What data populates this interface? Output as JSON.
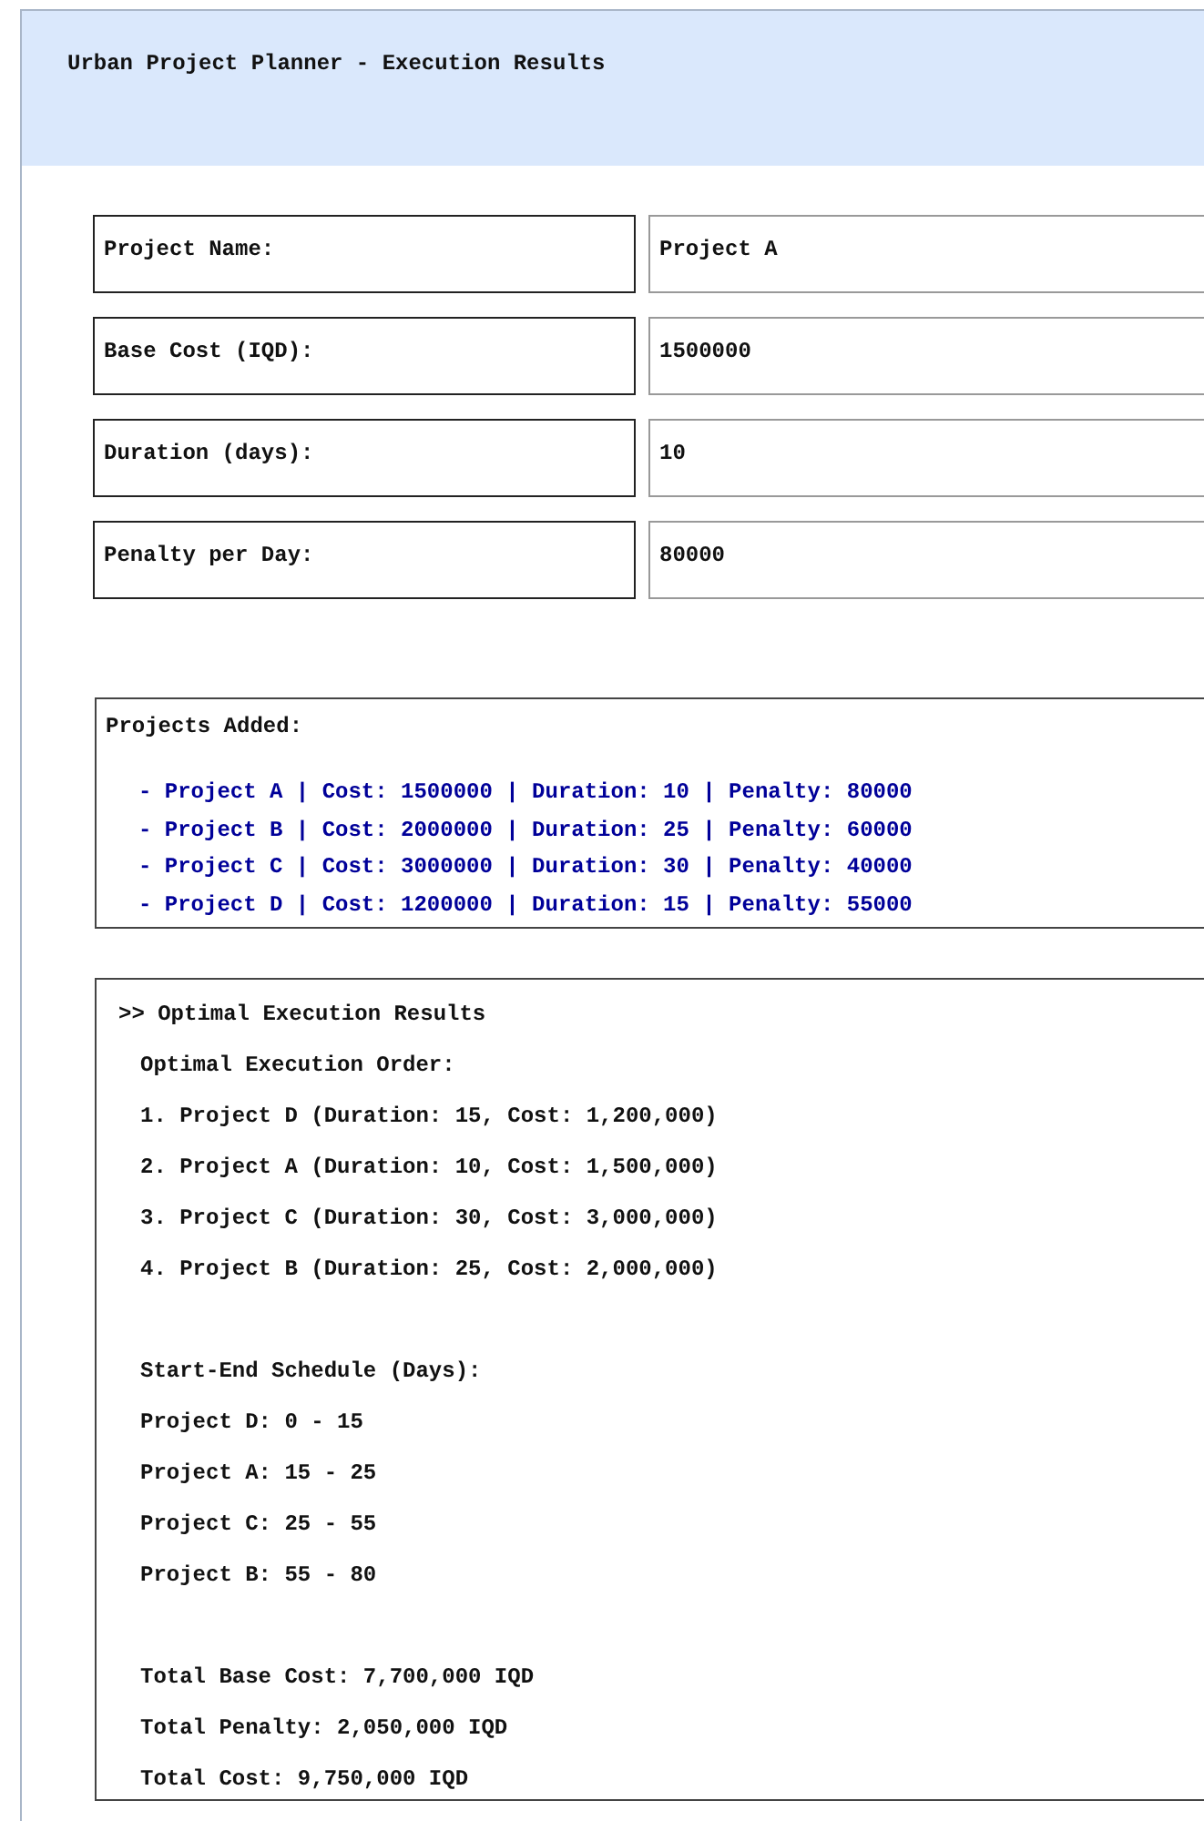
{
  "window": {
    "title": "Urban Project Planner - Execution Results"
  },
  "form": [
    {
      "label": "Project Name:",
      "value": "Project A"
    },
    {
      "label": "Base Cost (IQD):",
      "value": "1500000"
    },
    {
      "label": "Duration (days):",
      "value": "10"
    },
    {
      "label": "Penalty per Day:",
      "value": "80000"
    }
  ],
  "projects_added": {
    "title": "Projects Added:",
    "items": [
      "- Project A | Cost: 1500000 | Duration: 10 | Penalty: 80000",
      "- Project B | Cost: 2000000 | Duration: 25 | Penalty: 60000",
      "- Project C | Cost: 3000000 | Duration: 30 | Penalty: 40000",
      "- Project D | Cost: 1200000 | Duration: 15 | Penalty: 55000"
    ]
  },
  "results": {
    "heading": ">> Optimal Execution Results",
    "order_title": "Optimal Execution Order:",
    "order": [
      "1. Project D (Duration: 15, Cost: 1,200,000)",
      "2. Project A (Duration: 10, Cost: 1,500,000)",
      "3. Project C (Duration: 30, Cost: 3,000,000)",
      "4. Project B (Duration: 25, Cost: 2,000,000)"
    ],
    "schedule_title": "Start-End Schedule (Days):",
    "schedule": [
      "Project D: 0 - 15",
      "Project A: 15 - 25",
      "Project C: 25 - 55",
      "Project B: 55 - 80"
    ],
    "totals": [
      "Total Base Cost: 7,700,000 IQD",
      "Total Penalty: 2,050,000 IQD",
      "Total Cost: 9,750,000 IQD"
    ]
  }
}
